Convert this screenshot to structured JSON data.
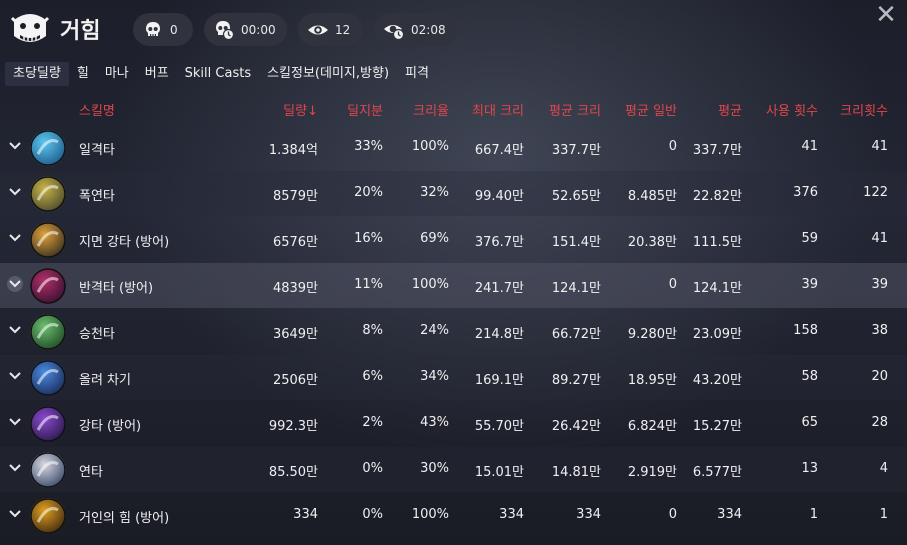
{
  "header": {
    "title": "거힘",
    "stats": {
      "deaths": "0",
      "death_time": "00:00",
      "views": "12",
      "view_time": "02:08"
    },
    "close_label": "✕"
  },
  "tabs": [
    "초당딜량",
    "힐",
    "마나",
    "버프",
    "Skill Casts",
    "스킬정보(데미지,방향)",
    "피격"
  ],
  "table": {
    "headers": [
      "스킬명",
      "딜량↓",
      "딜지분",
      "크리율",
      "최대 크리",
      "평균 크리",
      "평균 일반",
      "평균",
      "사용 횟수",
      "크리횟수"
    ],
    "rows": [
      {
        "name": "일격타",
        "damage": "1.384억",
        "share": "33%",
        "crit_rate": "100%",
        "max_crit": "667.4만",
        "avg_crit": "337.7만",
        "avg_normal": "0",
        "avg": "337.7만",
        "uses": "41",
        "crits": "41"
      },
      {
        "name": "폭연타",
        "damage": "8579만",
        "share": "20%",
        "crit_rate": "32%",
        "max_crit": "99.40만",
        "avg_crit": "52.65만",
        "avg_normal": "8.485만",
        "avg": "22.82만",
        "uses": "376",
        "crits": "122"
      },
      {
        "name": "지면 강타 (방어)",
        "damage": "6576만",
        "share": "16%",
        "crit_rate": "69%",
        "max_crit": "376.7만",
        "avg_crit": "151.4만",
        "avg_normal": "20.38만",
        "avg": "111.5만",
        "uses": "59",
        "crits": "41"
      },
      {
        "name": "반격타 (방어)",
        "damage": "4839만",
        "share": "11%",
        "crit_rate": "100%",
        "max_crit": "241.7만",
        "avg_crit": "124.1만",
        "avg_normal": "0",
        "avg": "124.1만",
        "uses": "39",
        "crits": "39"
      },
      {
        "name": "승천타",
        "damage": "3649만",
        "share": "8%",
        "crit_rate": "24%",
        "max_crit": "214.8만",
        "avg_crit": "66.72만",
        "avg_normal": "9.280만",
        "avg": "23.09만",
        "uses": "158",
        "crits": "38"
      },
      {
        "name": "올려 차기",
        "damage": "2506만",
        "share": "6%",
        "crit_rate": "34%",
        "max_crit": "169.1만",
        "avg_crit": "89.27만",
        "avg_normal": "18.95만",
        "avg": "43.20만",
        "uses": "58",
        "crits": "20"
      },
      {
        "name": "강타 (방어)",
        "damage": "992.3만",
        "share": "2%",
        "crit_rate": "43%",
        "max_crit": "55.70만",
        "avg_crit": "26.42만",
        "avg_normal": "6.824만",
        "avg": "15.27만",
        "uses": "65",
        "crits": "28"
      },
      {
        "name": "연타",
        "damage": "85.50만",
        "share": "0%",
        "crit_rate": "30%",
        "max_crit": "15.01만",
        "avg_crit": "14.81만",
        "avg_normal": "2.919만",
        "avg": "6.577만",
        "uses": "13",
        "crits": "4"
      },
      {
        "name": "거인의 힘 (방어)",
        "damage": "334",
        "share": "0%",
        "crit_rate": "100%",
        "max_crit": "334",
        "avg_crit": "334",
        "avg_normal": "0",
        "avg": "334",
        "uses": "1",
        "crits": "1"
      }
    ]
  },
  "colors": {
    "header_text": "#e0464b",
    "background": "#1b1d27",
    "highlight_row": "#4a4c5c"
  },
  "icons": [
    "skull-icon",
    "skull-clock-icon",
    "eye-icon",
    "eye-clock-icon",
    "close-icon",
    "chevron-down-icon"
  ]
}
